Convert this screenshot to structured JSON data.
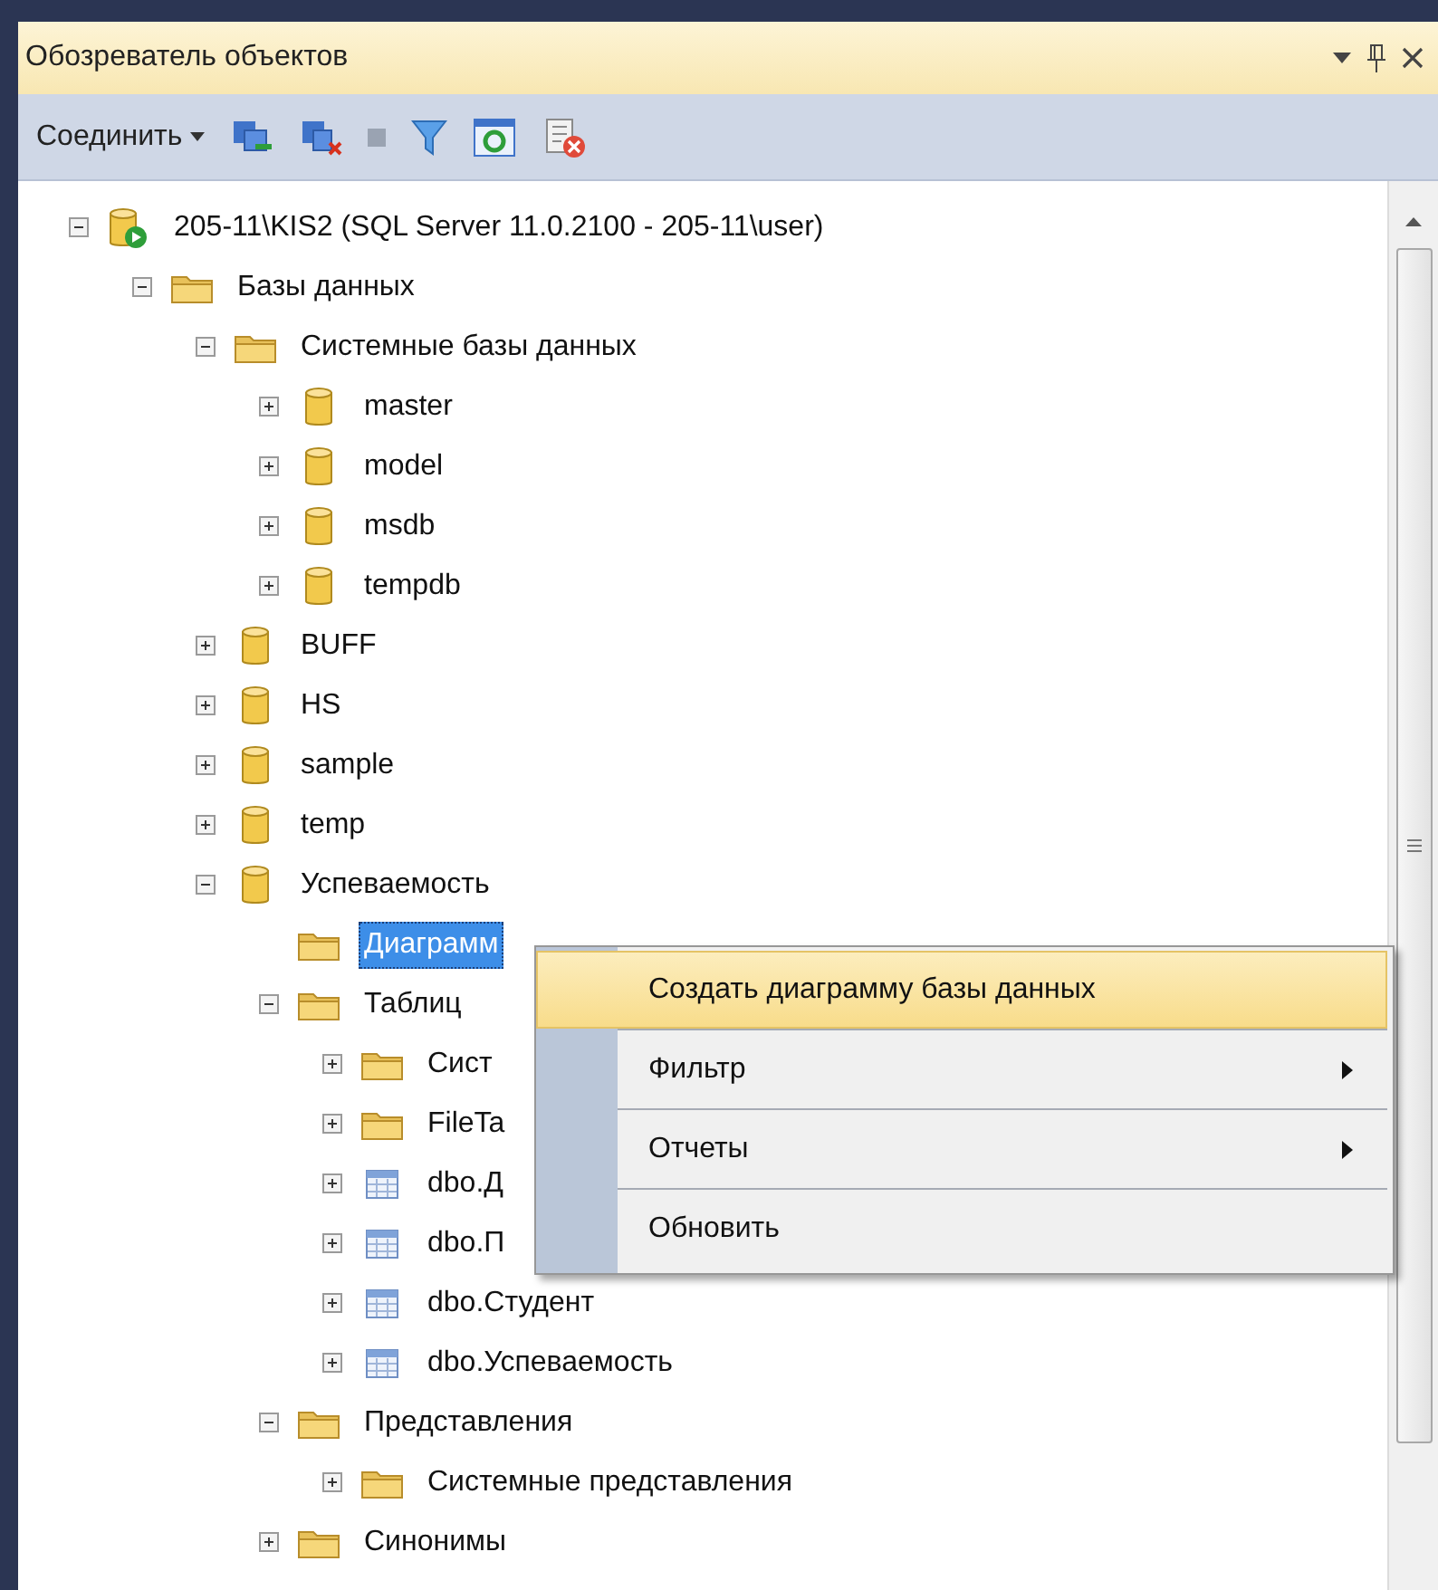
{
  "panel": {
    "title": "Обозреватель объектов"
  },
  "toolbar": {
    "connect_label": "Соединить"
  },
  "tree": [
    {
      "label": "205-11\\KIS2 (SQL Server 11.0.2100 - 205-11\\user)",
      "kind": "server",
      "expanded": true,
      "selected": false,
      "children": [
        {
          "label": "Базы данных",
          "kind": "folder",
          "expanded": true,
          "selected": false,
          "children": [
            {
              "label": "Системные базы данных",
              "kind": "folder",
              "expanded": true,
              "selected": false,
              "children": [
                {
                  "label": "master",
                  "kind": "database",
                  "expanded": false,
                  "selected": false
                },
                {
                  "label": "model",
                  "kind": "database",
                  "expanded": false,
                  "selected": false
                },
                {
                  "label": "msdb",
                  "kind": "database",
                  "expanded": false,
                  "selected": false
                },
                {
                  "label": "tempdb",
                  "kind": "database",
                  "expanded": false,
                  "selected": false
                }
              ]
            },
            {
              "label": "BUFF",
              "kind": "database",
              "expanded": false,
              "selected": false
            },
            {
              "label": "HS",
              "kind": "database",
              "expanded": false,
              "selected": false
            },
            {
              "label": "sample",
              "kind": "database",
              "expanded": false,
              "selected": false
            },
            {
              "label": "temp",
              "kind": "database",
              "expanded": false,
              "selected": false
            },
            {
              "label": "Успеваемость",
              "kind": "database",
              "expanded": true,
              "selected": false,
              "children": [
                {
                  "label": "Диаграмм",
                  "kind": "folder",
                  "selected": true
                },
                {
                  "label": "Таблиц",
                  "kind": "folder",
                  "expanded": true,
                  "selected": false,
                  "children": [
                    {
                      "label": "Сист",
                      "kind": "folder",
                      "expanded": false,
                      "selected": false
                    },
                    {
                      "label": "FileTa",
                      "kind": "folder",
                      "expanded": false,
                      "selected": false
                    },
                    {
                      "label": "dbo.Д",
                      "kind": "table",
                      "expanded": false,
                      "selected": false
                    },
                    {
                      "label": "dbo.П",
                      "kind": "table",
                      "expanded": false,
                      "selected": false
                    },
                    {
                      "label": "dbo.Студент",
                      "kind": "table",
                      "expanded": false,
                      "selected": false
                    },
                    {
                      "label": "dbo.Успеваемость",
                      "kind": "table",
                      "expanded": false,
                      "selected": false
                    }
                  ]
                },
                {
                  "label": "Представления",
                  "kind": "folder",
                  "expanded": true,
                  "selected": false,
                  "children": [
                    {
                      "label": "Системные представления",
                      "kind": "folder",
                      "expanded": false,
                      "selected": false
                    }
                  ]
                },
                {
                  "label": "Синонимы",
                  "kind": "folder",
                  "expanded": false,
                  "selected": false
                }
              ]
            }
          ]
        }
      ]
    }
  ],
  "context_menu": [
    {
      "label": "Создать диаграмму базы данных",
      "selected": true,
      "submenu": false
    },
    {
      "label": "Фильтр",
      "selected": false,
      "submenu": true
    },
    {
      "label": "Отчеты",
      "selected": false,
      "submenu": true
    },
    {
      "label": "Обновить",
      "selected": false,
      "submenu": false
    }
  ]
}
